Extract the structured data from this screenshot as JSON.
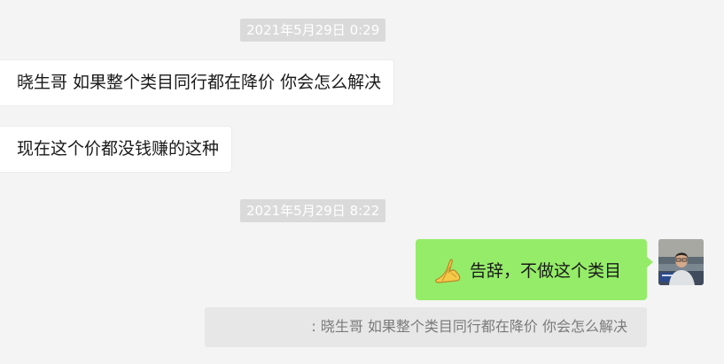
{
  "messages": [
    {
      "type": "timestamp",
      "text": "2021年5月29日 0:29"
    },
    {
      "type": "incoming",
      "text": "晓生哥 如果整个类目同行都在降价 你会怎么解决"
    },
    {
      "type": "incoming",
      "text": "现在这个价都没钱赚的这种"
    },
    {
      "type": "timestamp",
      "text": "2021年5月29日 8:22"
    },
    {
      "type": "outgoing",
      "emoji_icon": "folded-hands-icon",
      "text": "告辞，不做这个类目"
    },
    {
      "type": "quote",
      "text": ": 晓生哥 如果整个类目同行都在降价 你会怎么解决"
    }
  ],
  "colors": {
    "background": "#f4f4f4",
    "incoming_bubble": "#ffffff",
    "outgoing_bubble": "#95ec69",
    "timestamp_bg": "#dadada",
    "quote_bg": "#e7e7e7"
  }
}
